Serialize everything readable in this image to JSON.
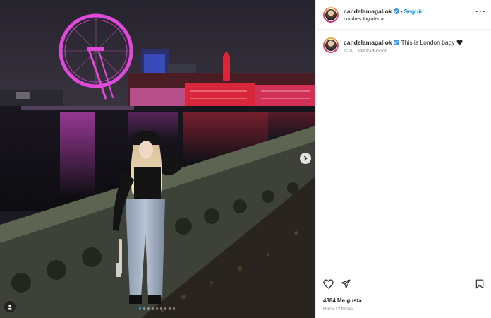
{
  "post": {
    "username": "candelamagaliok",
    "follow_label": "Seguir",
    "separator": "•",
    "location": "Londres Inglaterra",
    "more_label": "···",
    "caption_text": "This is London baby",
    "caption_emoji": "heart-icon",
    "time_short": "12 h",
    "translate_label": "Ver traducción",
    "likes_text": "4384 Me gusta",
    "time_ago": "Hace 12 horas"
  },
  "carousel": {
    "dot_count": 9,
    "active_index": 0
  },
  "colors": {
    "accent_blue": "#0095f6",
    "verified_blue": "#3897f0",
    "eye_pink": "#e04ad8",
    "building_red": "#d8263a"
  },
  "icons": [
    "verified-badge-icon",
    "more-options-icon",
    "heart-icon",
    "share-icon",
    "bookmark-icon",
    "chevron-right-icon",
    "user-tag-icon"
  ]
}
